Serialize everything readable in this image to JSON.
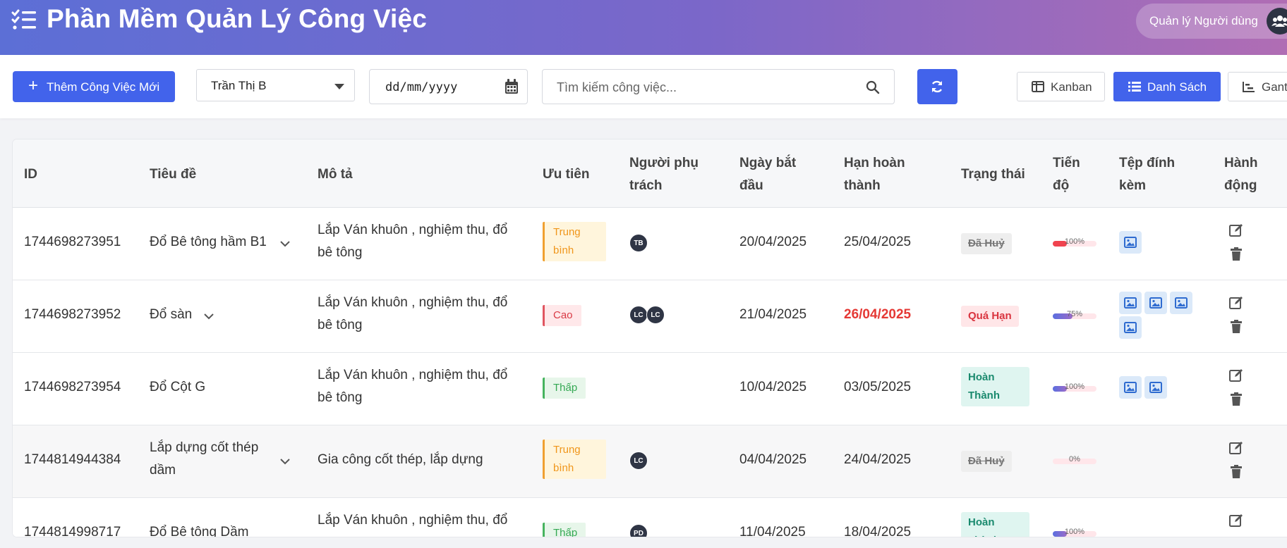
{
  "header": {
    "title": "Phần Mềm Quản Lý Công Việc",
    "user_management": "Quản lý Người dùng"
  },
  "toolbar": {
    "add_label": "Thêm Công Việc Mới",
    "assignee_selected": "Trần Thị B",
    "date_placeholder": "dd/mm/yyyy",
    "search_placeholder": "Tìm kiếm công việc...",
    "views": {
      "kanban": "Kanban",
      "list": "Danh Sách",
      "gantt": "Gantt"
    }
  },
  "table": {
    "columns": {
      "id": "ID",
      "title": "Tiêu đề",
      "desc": "Mô tả",
      "priority": "Ưu tiên",
      "assignee": "Người phụ trách",
      "start": "Ngày bắt đầu",
      "due": "Hạn hoàn thành",
      "status": "Trạng thái",
      "progress": "Tiến độ",
      "attachments": "Tệp đính kèm",
      "actions": "Hành động"
    },
    "rows": [
      {
        "id": "1744698273951",
        "title": "Đổ Bê tông hầm B1",
        "desc": "Lắp Ván khuôn , nghiệm thu, đổ bê tông",
        "priority": "Trung bình",
        "assignees": [
          "TB"
        ],
        "start": "20/04/2025",
        "due": "25/04/2025",
        "status": "Đã Huỷ",
        "progress": 1.0,
        "progress_label": "100%",
        "attachments": 1
      },
      {
        "id": "1744698273952",
        "title": "Đổ sàn",
        "desc": "Lắp Ván khuôn , nghiệm thu, đổ bê tông",
        "priority": "Cao",
        "assignees": [
          "LC",
          "LC"
        ],
        "start": "21/04/2025",
        "due": "26/04/2025",
        "status": "Quá Hạn",
        "progress": 0.75,
        "progress_label": "75%",
        "attachments": 4
      },
      {
        "id": "1744698273954",
        "title": "Đổ Cột G",
        "desc": "Lắp Ván khuôn , nghiệm thu, đổ bê tông",
        "priority": "Thấp",
        "assignees": [],
        "start": "10/04/2025",
        "due": "03/05/2025",
        "status": "Hoàn Thành",
        "progress": 1.0,
        "progress_label": "100%",
        "attachments": 2
      },
      {
        "id": "1744814944384",
        "title": "Lắp dựng cốt thép dầm",
        "desc": "Gia công cốt thép, lắp dựng",
        "priority": "Trung bình",
        "assignees": [
          "LC"
        ],
        "start": "04/04/2025",
        "due": "24/04/2025",
        "status": "Đã Huỷ",
        "progress": 0.0,
        "progress_label": "0%",
        "attachments": 0
      },
      {
        "id": "1744814998717",
        "title": "Đổ Bê tông Dầm",
        "desc": "Lắp Ván khuôn , nghiệm thu, đổ bê tông",
        "priority": "Thấp",
        "assignees": [
          "PD"
        ],
        "start": "11/04/2025",
        "due": "18/04/2025",
        "status": "Hoàn Thành",
        "progress": 1.0,
        "progress_label": "100%",
        "attachments": 0
      }
    ]
  },
  "colors": {
    "primary": "#4263eb",
    "overdue": "#e53935",
    "progress_red": "#f0434f",
    "progress_gradient_start": "#5a6fe0",
    "progress_gradient_end": "#9b6bc8"
  },
  "icons": {
    "header": "task-list-icon",
    "user_management": "users-icon",
    "date": "calendar-icon",
    "search": "search-icon",
    "refresh": "refresh-icon",
    "kanban": "columns-icon",
    "list": "list-icon",
    "gantt": "chart-icon",
    "attachment": "image-icon",
    "edit": "edit-icon",
    "delete": "trash-icon"
  }
}
